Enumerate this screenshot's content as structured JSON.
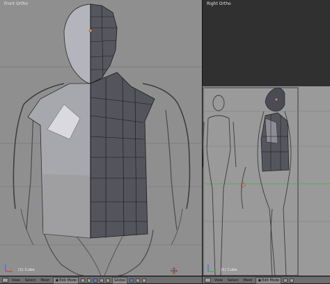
{
  "front_viewport": {
    "title": "Front Ortho",
    "status": "(1) Cube"
  },
  "right_viewport": {
    "title": "Right Ortho",
    "status": "(1) Cube"
  },
  "front_header": {
    "menu": [
      "View",
      "Select",
      "Mesh"
    ],
    "mode": "Edit Mode",
    "orientation": "Global"
  },
  "right_header": {
    "menu": [
      "View",
      "Select",
      "Mesh"
    ],
    "mode": "Edit Mode"
  },
  "colors": {
    "viewport_bg": "#8f8f8f",
    "right_viewport_bg": "#303030",
    "mesh_light": "#b7b7bf",
    "mesh_dark": "#4a4a52",
    "header_bg": "#6e6e6e",
    "accent_blue": "#5680c2",
    "cursor_red": "#d33a2c"
  }
}
